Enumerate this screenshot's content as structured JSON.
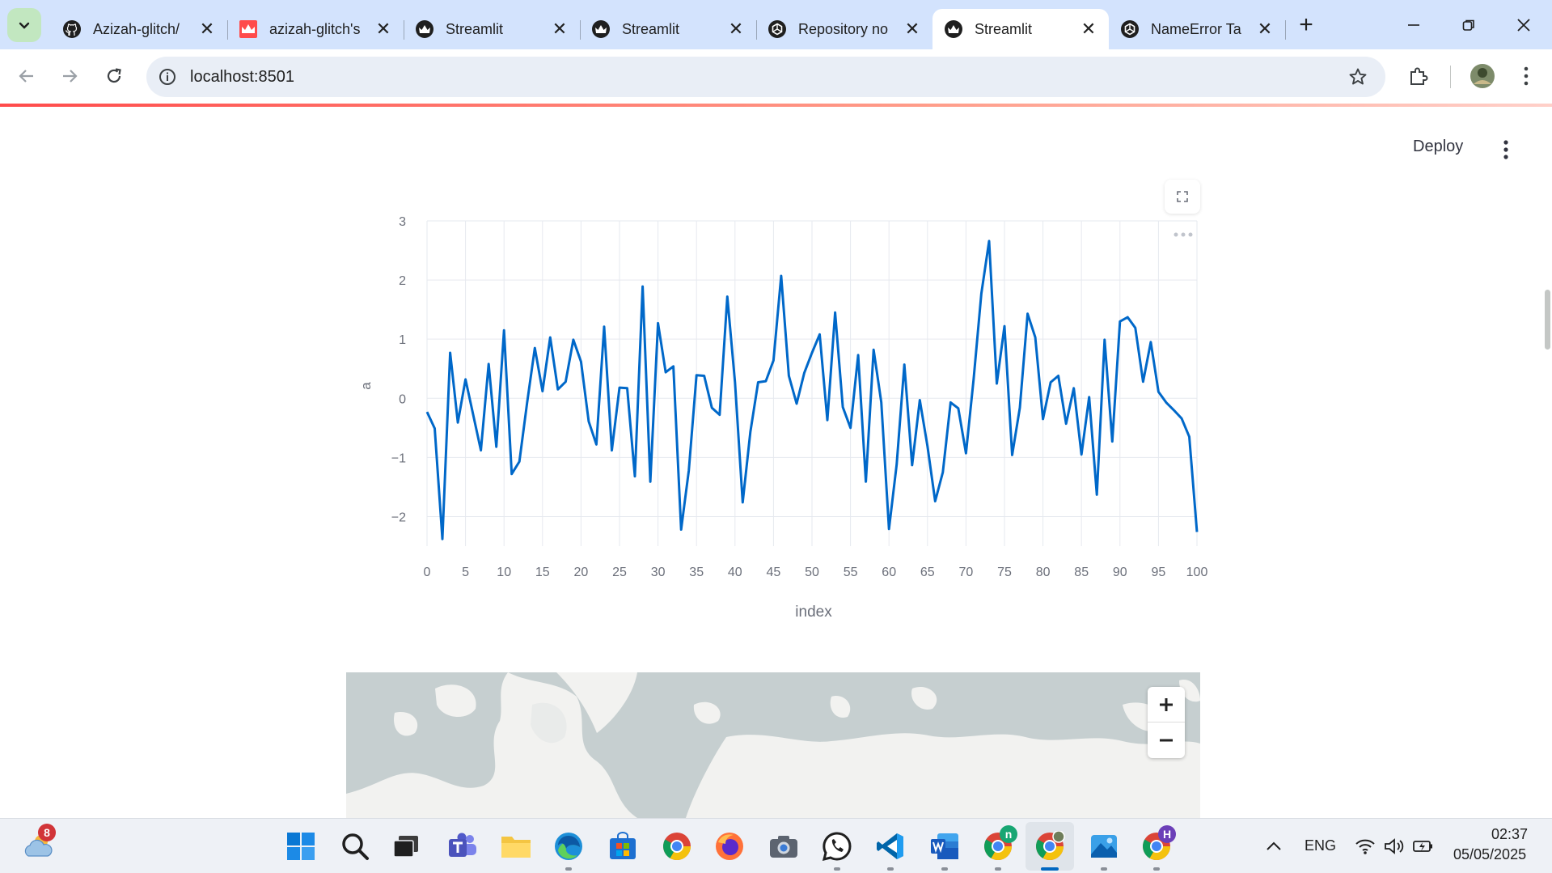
{
  "browser": {
    "tabs": [
      {
        "title": "Azizah-glitch/",
        "icon": "github-icon",
        "active": false
      },
      {
        "title": "azizah-glitch's",
        "icon": "streamlit-crown-red-icon",
        "active": false
      },
      {
        "title": "Streamlit",
        "icon": "streamlit-crown-icon",
        "active": false
      },
      {
        "title": "Streamlit",
        "icon": "streamlit-crown-icon",
        "active": false
      },
      {
        "title": "Repository no",
        "icon": "openai-icon",
        "active": false
      },
      {
        "title": "Streamlit",
        "icon": "streamlit-crown-icon",
        "active": true
      },
      {
        "title": "NameError Ta",
        "icon": "openai-icon",
        "active": false
      }
    ],
    "close_glyph": "✕",
    "new_tab_glyph": "+",
    "url": "localhost:8501"
  },
  "app": {
    "deploy_label": "Deploy"
  },
  "chart_data": {
    "type": "line",
    "xlabel": "index",
    "ylabel": "a",
    "xlim": [
      0,
      100
    ],
    "ylim": [
      -2.5,
      3
    ],
    "xticks": [
      0,
      5,
      10,
      15,
      20,
      25,
      30,
      35,
      40,
      45,
      50,
      55,
      60,
      65,
      70,
      75,
      80,
      85,
      90,
      95,
      100
    ],
    "yticks": [
      3,
      2,
      1,
      0,
      -1,
      -2
    ],
    "grid": true,
    "color": "#0068c9",
    "series": [
      {
        "values": [
          -0.23,
          -0.51,
          -2.38,
          0.77,
          -0.41,
          0.32,
          -0.28,
          -0.88,
          0.58,
          -0.82,
          1.15,
          -1.28,
          -1.07,
          -0.07,
          0.85,
          0.12,
          1.03,
          0.15,
          0.28,
          0.99,
          0.62,
          -0.39,
          -0.78,
          1.21,
          -0.88,
          0.18,
          0.17,
          -1.32,
          1.89,
          -1.41,
          1.27,
          0.44,
          0.54,
          -2.22,
          -1.22,
          0.39,
          0.38,
          -0.16,
          -0.28,
          1.72,
          0.27,
          -1.76,
          -0.57,
          0.27,
          0.29,
          0.64,
          2.07,
          0.38,
          -0.09,
          0.43,
          0.77,
          1.08,
          -0.37,
          1.45,
          -0.15,
          -0.5,
          0.73,
          -1.41,
          0.82,
          -0.07,
          -2.21,
          -1.12,
          0.57,
          -1.13,
          -0.03,
          -0.81,
          -1.74,
          -1.25,
          -0.07,
          -0.17,
          -0.93,
          0.33,
          1.77,
          2.66,
          0.25,
          1.22,
          -0.96,
          -0.16,
          1.43,
          1.03,
          -0.35,
          0.27,
          0.38,
          -0.43,
          0.17,
          -0.95,
          0.02,
          -1.63,
          0.99,
          -0.73,
          1.3,
          1.37,
          1.19,
          0.28,
          0.95,
          0.11,
          -0.07,
          -0.2,
          -0.34,
          -0.65,
          -2.26
        ]
      }
    ]
  },
  "taskbar": {
    "weather_badge": "8",
    "tray_lang": "ENG",
    "time": "02:37",
    "date": "05/05/2025",
    "chrome_badge_n": "n",
    "chrome_badge_h": "H",
    "chevron_glyph": "^"
  }
}
